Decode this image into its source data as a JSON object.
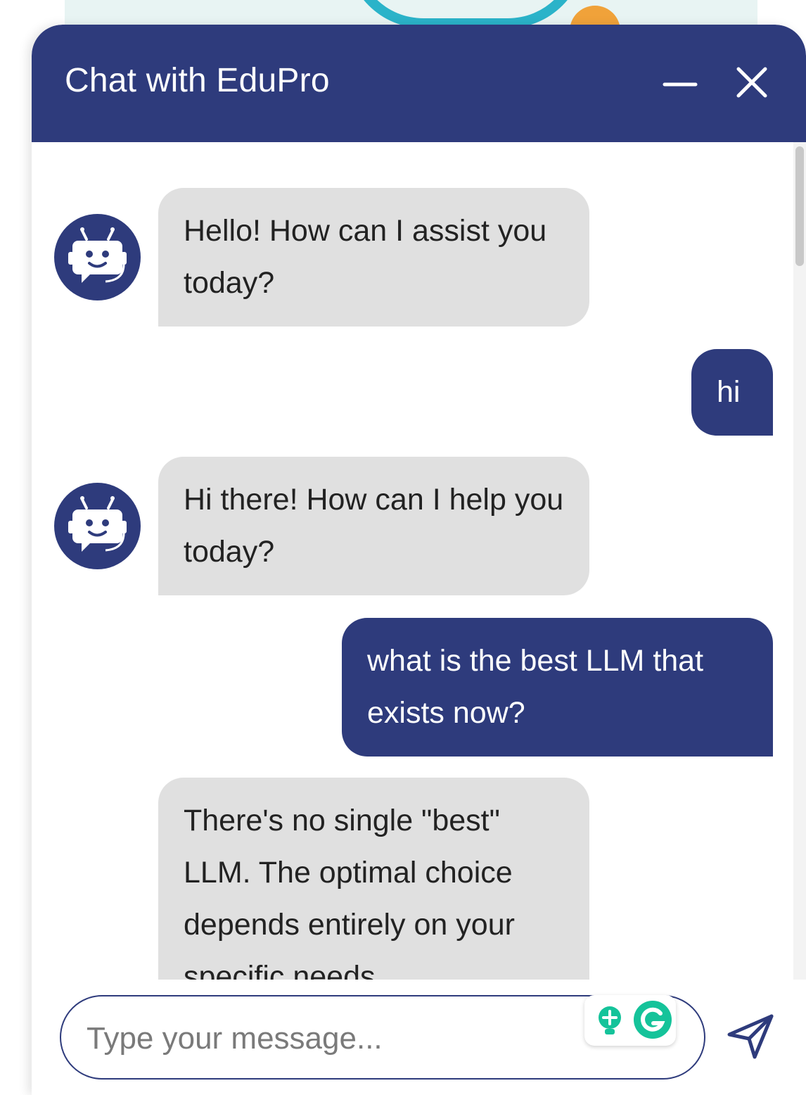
{
  "header": {
    "title": "Chat with EduPro"
  },
  "messages": [
    {
      "sender": "bot",
      "text": "Hello! How can I assist you today?"
    },
    {
      "sender": "user",
      "text": "hi"
    },
    {
      "sender": "bot",
      "text": "Hi there! How can I help you today?"
    },
    {
      "sender": "user",
      "text": "what is the best LLM that exists now?"
    },
    {
      "sender": "bot",
      "text": "There's no single \"best\" LLM. The optimal choice depends entirely on your specific needs"
    }
  ],
  "input": {
    "placeholder": "Type your message..."
  },
  "colors": {
    "primary": "#2e3b7c",
    "bot_bubble": "#e0e0e0",
    "grammarly_green": "#15c39a"
  }
}
